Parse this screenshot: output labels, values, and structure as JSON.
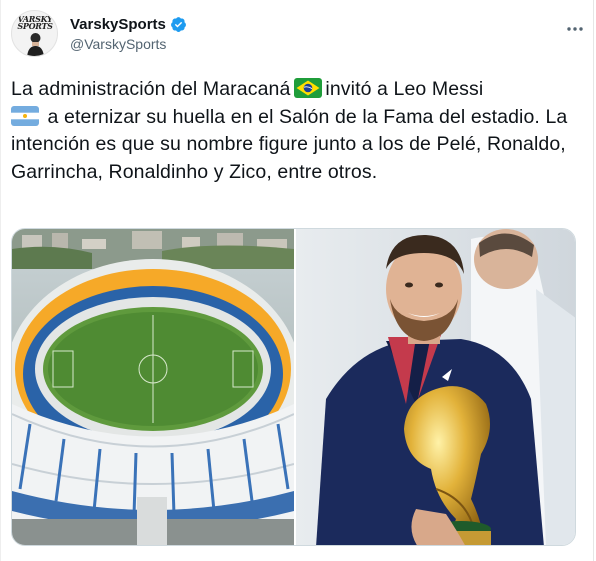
{
  "tweet": {
    "author": {
      "display_name": "VarskySports",
      "handle": "@VarskySports",
      "verified": true,
      "avatar_logo_text": "VARSKY SPORTS"
    },
    "text_parts": [
      "La administración del Maracaná",
      "invitó a Leo Messi",
      "a eternizar su huella en el Salón de la Fama del estadio. La intención es que su nombre figure junto a los de Pelé, Ronaldo, Garrincha, Ronaldinho y Zico, entre otros."
    ],
    "flags": [
      "brazil-flag",
      "argentina-flag"
    ],
    "media": [
      {
        "name": "stadium-photo"
      },
      {
        "name": "messi-trophy-photo"
      }
    ]
  },
  "colors": {
    "verified_blue": "#1d9bf0",
    "text": "#0f1419",
    "secondary_text": "#536471",
    "border": "#cfd9de"
  },
  "icons": [
    "verified-badge-icon",
    "more-options-icon"
  ]
}
